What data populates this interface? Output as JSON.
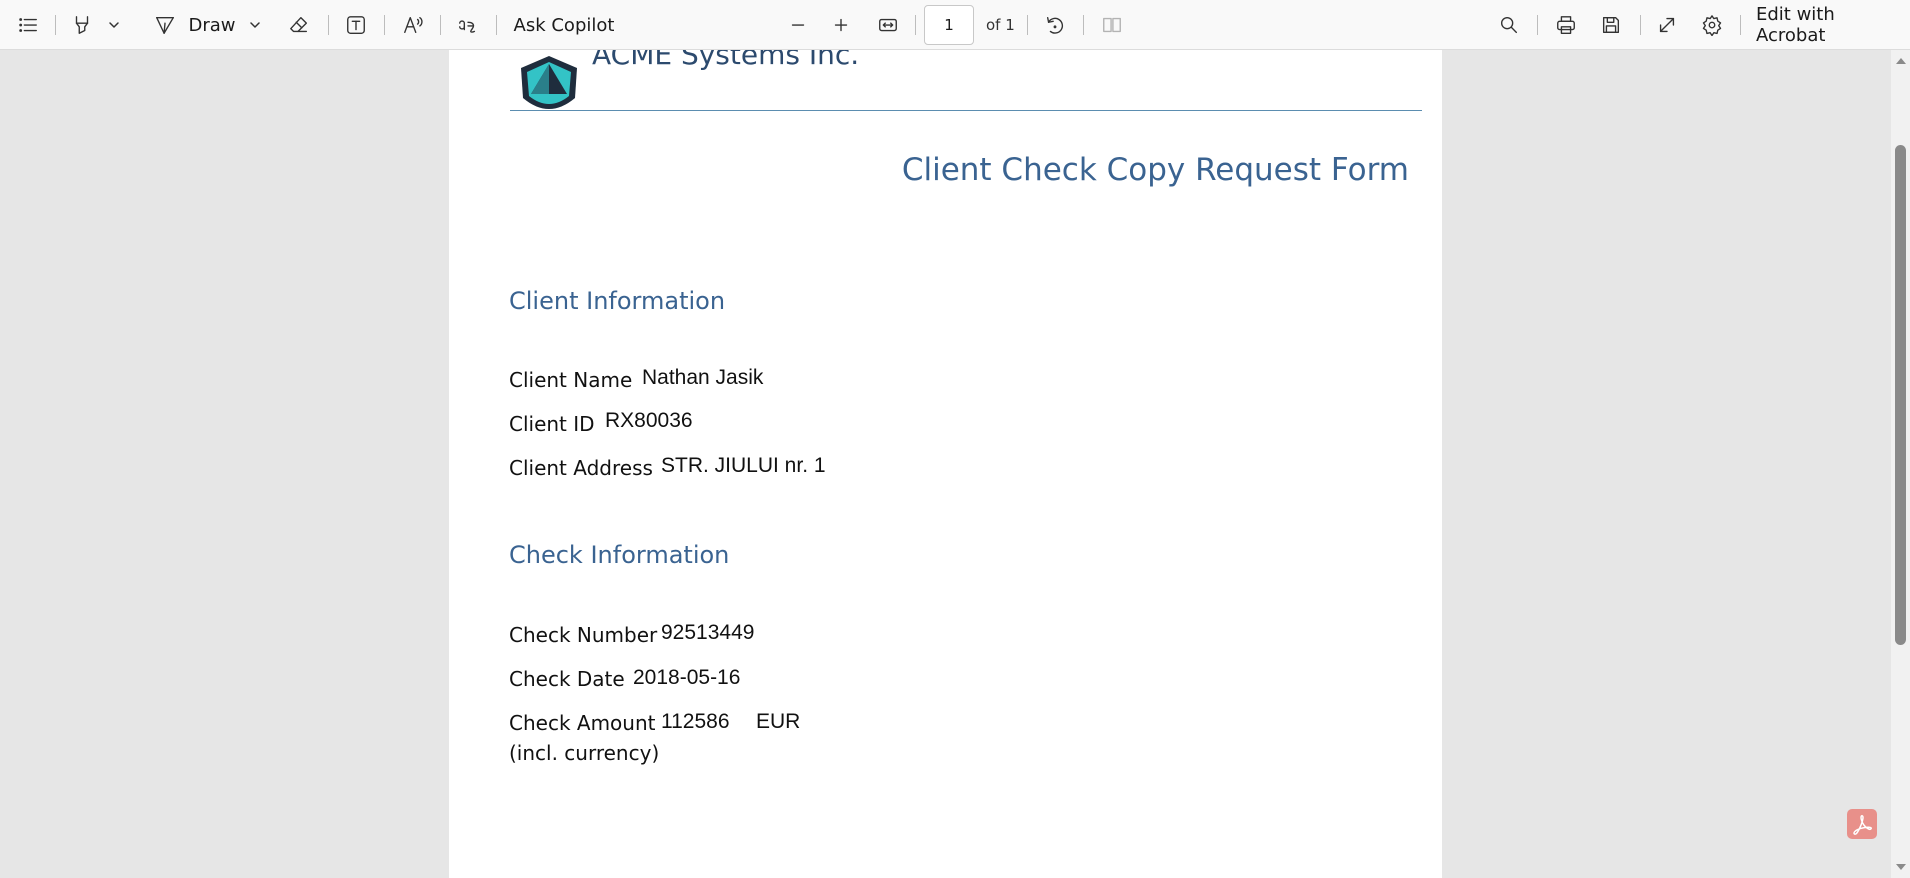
{
  "toolbar": {
    "draw_label": "Draw",
    "ask_copilot_label": "Ask Copilot",
    "page_number": "1",
    "page_total_label": "of 1",
    "edit_label": "Edit with Acrobat",
    "icons": [
      "contents-icon",
      "highlight-icon",
      "chevron-down-icon",
      "draw-icon",
      "eraser-icon",
      "text-box-icon",
      "read-aloud-icon",
      "translate-icon",
      "zoom-out-icon",
      "zoom-in-icon",
      "fit-width-icon",
      "rotate-icon",
      "two-page-icon",
      "search-icon",
      "print-icon",
      "save-icon",
      "expand-icon",
      "settings-icon"
    ]
  },
  "document": {
    "company_name": "ACME Systems Inc.",
    "form_title": "Client Check Copy Request Form",
    "client_section": {
      "heading": "Client Information",
      "name_label": "Client Name",
      "name_value": "Nathan Jasik",
      "id_label": "Client ID",
      "id_value": "RX80036",
      "address_label": "Client Address",
      "address_value": "STR. JIULUI nr. 1"
    },
    "check_section": {
      "heading": "Check Information",
      "number_label": "Check Number",
      "number_value": "92513449",
      "date_label": "Check Date",
      "date_value": "2018-05-16",
      "amount_label_line1": "Check Amount",
      "amount_label_line2": "(incl. currency)",
      "amount_value": "112586",
      "currency_value": "EUR"
    }
  },
  "colors": {
    "heading_blue": "#3a6391",
    "rule_blue": "#5b8db0",
    "toolbar_bg": "#f9f9f9",
    "viewer_bg": "#e6e6e6",
    "acrobat_badge": "#e8908a"
  }
}
